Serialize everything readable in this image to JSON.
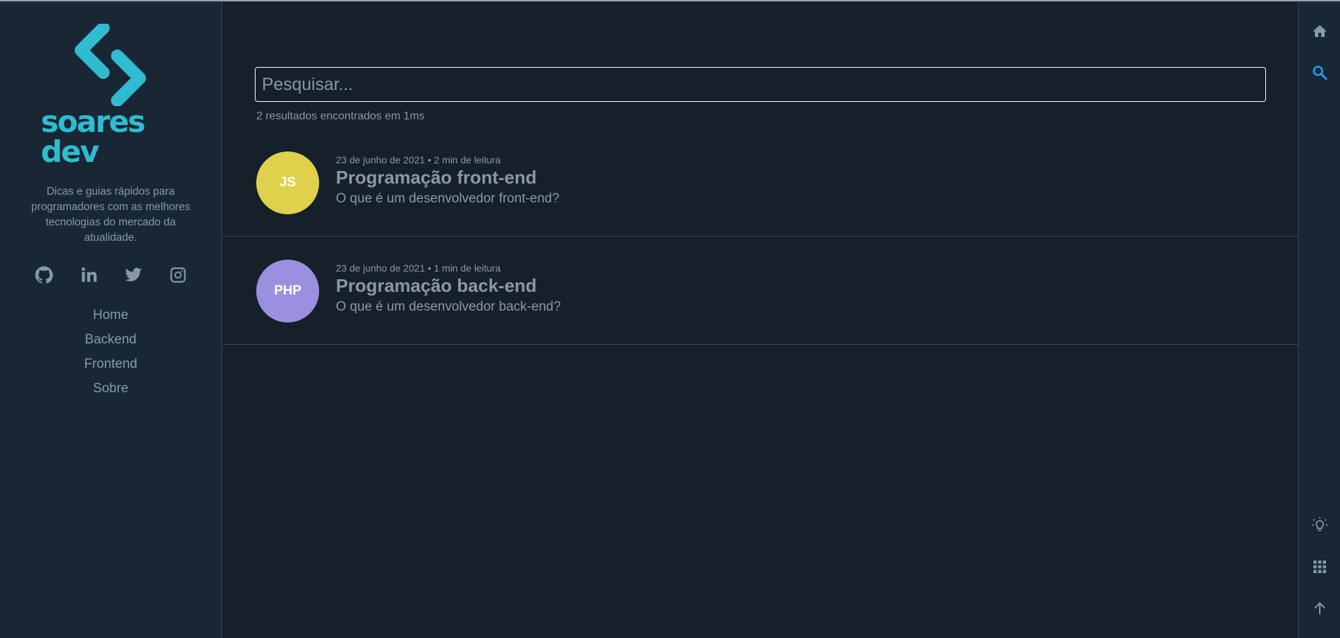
{
  "brand": {
    "logo_text": "soares dev",
    "tagline": "Dicas e guias rápidos para programadores com as melhores tecnologias do mercado da atualidade.",
    "accent_color": "#2fbcd1"
  },
  "social": [
    {
      "name": "github-icon"
    },
    {
      "name": "linkedin-icon"
    },
    {
      "name": "twitter-icon"
    },
    {
      "name": "instagram-icon"
    }
  ],
  "nav": {
    "items": [
      {
        "label": "Home"
      },
      {
        "label": "Backend"
      },
      {
        "label": "Frontend"
      },
      {
        "label": "Sobre"
      }
    ]
  },
  "search": {
    "placeholder": "Pesquisar...",
    "value": "",
    "results_text": "2 resultados encontrados em 1ms"
  },
  "posts": [
    {
      "badge": "JS",
      "badge_color": "#e0d14d",
      "meta": "23 de junho de 2021 • 2 min de leitura",
      "title": "Programação front-end",
      "description": "O que é um desenvolvedor front-end?"
    },
    {
      "badge": "PHP",
      "badge_color": "#9b90e0",
      "meta": "23 de junho de 2021 • 1 min de leitura",
      "title": "Programação back-end",
      "description": "O que é um desenvolvedor back-end?"
    }
  ],
  "rightbar": {
    "icons": [
      "home-icon",
      "search-icon",
      "lightbulb-icon",
      "grid-icon",
      "arrow-up-icon"
    ],
    "active_color": "#1da1f2",
    "icon_color": "#8899a6"
  }
}
